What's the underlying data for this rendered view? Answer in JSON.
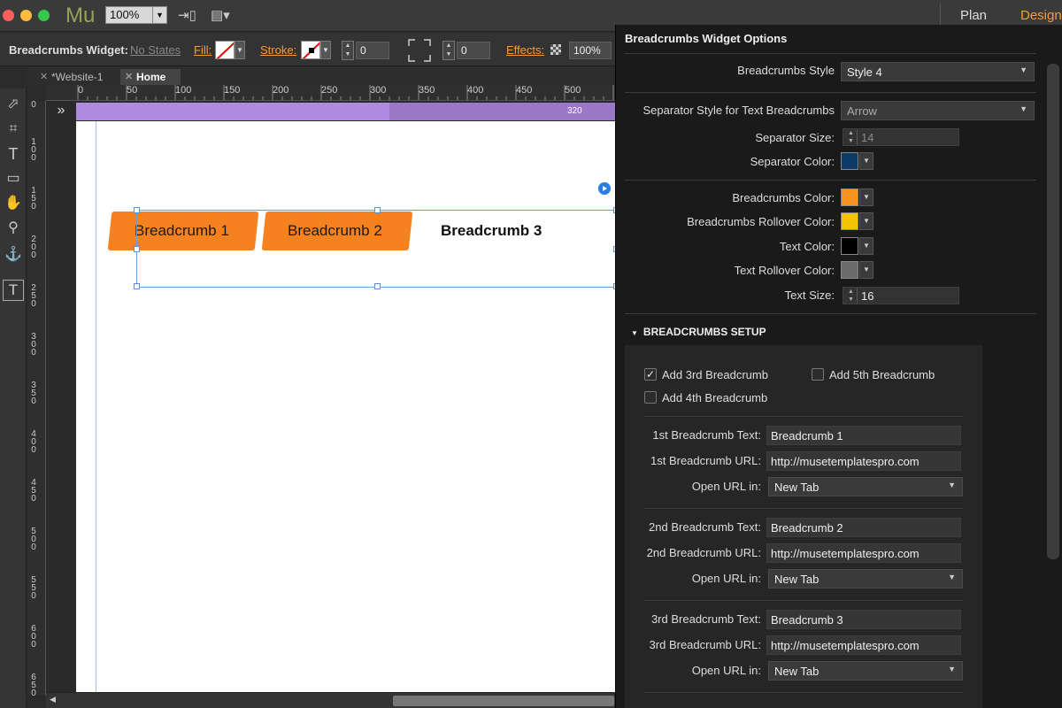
{
  "app": {
    "logo": "Mu",
    "zoom": "100%"
  },
  "workspace": {
    "plan": "Plan",
    "design": "Design"
  },
  "controlbar": {
    "widget_label": "Breadcrumbs Widget:",
    "states": "No States",
    "fill_label": "Fill:",
    "stroke_label": "Stroke:",
    "stroke_value": "0",
    "corner_value": "0",
    "effects_label": "Effects:",
    "opacity_value": "100%"
  },
  "tabs": [
    {
      "label": "*Website-1"
    },
    {
      "label": "Home"
    }
  ],
  "ruler": {
    "h_ticks": [
      "0",
      "50",
      "100",
      "150",
      "200",
      "250",
      "300",
      "350",
      "400",
      "450",
      "500"
    ],
    "v_ticks": [
      "0",
      "100",
      "150",
      "200",
      "250",
      "300",
      "350",
      "400",
      "450",
      "500",
      "550",
      "600",
      "650"
    ]
  },
  "canvas": {
    "breakpoint_value": "320",
    "breadcrumbs": [
      {
        "text": "Breadcrumb 1"
      },
      {
        "text": "Breadcrumb 2"
      },
      {
        "text": "Breadcrumb 3"
      }
    ],
    "breadcrumb_color": "#f5821f"
  },
  "panel": {
    "title": "Breadcrumbs Widget Options",
    "style_label": "Breadcrumbs Style",
    "style_value": "Style 4",
    "separator_style_label": "Separator Style for Text Breadcrumbs",
    "separator_style_value": "Arrow",
    "separator_size_label": "Separator Size:",
    "separator_size_value": "14",
    "separator_color_label": "Separator Color:",
    "separator_color": "#0e3a66",
    "breadcrumbs_color_label": "Breadcrumbs Color:",
    "breadcrumbs_color": "#f7941d",
    "rollover_color_label": "Breadcrumbs Rollover Color:",
    "rollover_color": "#f5c400",
    "text_color_label": "Text Color:",
    "text_color": "#000000",
    "text_rollover_color_label": "Text Rollover Color:",
    "text_rollover_color": "#6b6b6b",
    "text_size_label": "Text Size:",
    "text_size_value": "16",
    "setup_header": "BREADCRUMBS SETUP",
    "checkboxes": [
      {
        "label": "Add 3rd Breadcrumb",
        "checked": "✓"
      },
      {
        "label": "Add 5th Breadcrumb",
        "checked": ""
      },
      {
        "label": "Add 4th Breadcrumb",
        "checked": ""
      }
    ],
    "crumbs": [
      {
        "text_label": "1st Breadcrumb Text:",
        "text_value": "Breadcrumb 1",
        "url_label": "1st Breadcrumb URL:",
        "url_value": "http://musetemplatespro.com",
        "open_label": "Open URL in:",
        "open_value": "New Tab"
      },
      {
        "text_label": "2nd Breadcrumb Text:",
        "text_value": "Breadcrumb 2",
        "url_label": "2nd Breadcrumb URL:",
        "url_value": "http://musetemplatespro.com",
        "open_label": "Open URL in:",
        "open_value": "New Tab"
      },
      {
        "text_label": "3rd Breadcrumb Text:",
        "text_value": "Breadcrumb 3",
        "url_label": "3rd Breadcrumb URL:",
        "url_value": "http://musetemplatespro.com",
        "open_label": "Open URL in:",
        "open_value": "New Tab"
      }
    ]
  }
}
